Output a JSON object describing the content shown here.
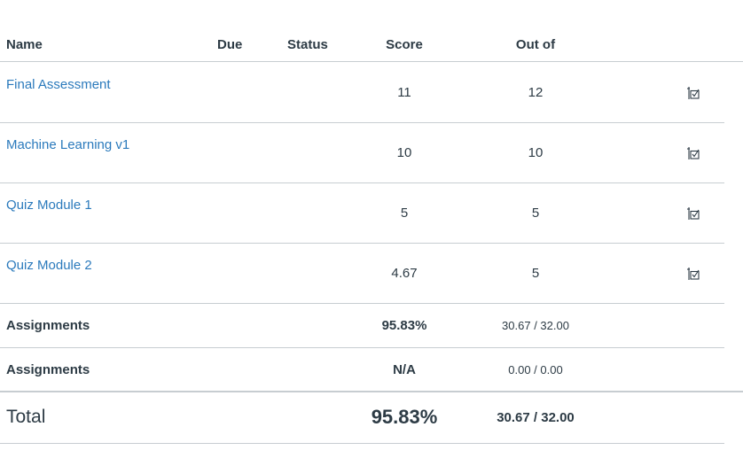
{
  "columns": {
    "name": "Name",
    "due": "Due",
    "status": "Status",
    "score": "Score",
    "out_of": "Out of"
  },
  "assignments": [
    {
      "name": "Final Assessment",
      "score": "11",
      "out_of": "12",
      "icon": "rubric-icon"
    },
    {
      "name": "Machine Learning v1",
      "score": "10",
      "out_of": "10",
      "icon": "rubric-icon"
    },
    {
      "name": "Quiz Module 1",
      "score": "5",
      "out_of": "5",
      "icon": "rubric-icon"
    },
    {
      "name": "Quiz Module 2",
      "score": "4.67",
      "out_of": "5",
      "icon": "rubric-icon"
    }
  ],
  "groups": [
    {
      "name": "Assignments",
      "score": "95.83%",
      "points": "30.67 / 32.00"
    },
    {
      "name": "Assignments",
      "score": "N/A",
      "points": "0.00 / 0.00"
    }
  ],
  "total": {
    "label": "Total",
    "score": "95.83%",
    "points": "30.67 / 32.00"
  },
  "colors": {
    "link": "#2b7abc",
    "text": "#2d3b45",
    "divider": "#c7cdd1"
  }
}
